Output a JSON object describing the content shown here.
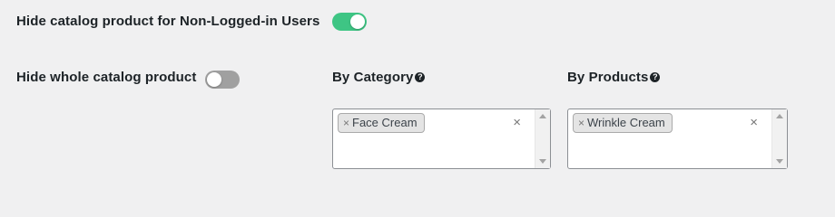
{
  "hide_non_logged": {
    "label": "Hide catalog product for Non-Logged-in Users",
    "enabled": true
  },
  "hide_whole": {
    "label": "Hide whole catalog product",
    "enabled": false
  },
  "by_category": {
    "label": "By Category",
    "help_icon": "?",
    "selected": [
      "Face Cream"
    ],
    "remove_glyph": "×",
    "clear_glyph": "×"
  },
  "by_products": {
    "label": "By Products",
    "help_icon": "?",
    "selected": [
      "Wrinkle Cream"
    ],
    "remove_glyph": "×",
    "clear_glyph": "×"
  },
  "colors": {
    "toggle_on": "#3ec584",
    "toggle_off": "#a0a0a0",
    "page_bg": "#f0f0f1"
  }
}
